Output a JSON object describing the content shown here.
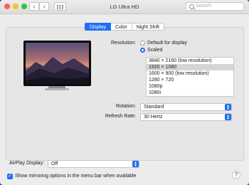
{
  "window": {
    "title": "LG Ultra HD"
  },
  "toolbar": {
    "back_glyph": "‹",
    "forward_glyph": "›",
    "search_placeholder": "Search"
  },
  "tabs": [
    {
      "label": "Display",
      "active": true
    },
    {
      "label": "Color",
      "active": false
    },
    {
      "label": "Night Shift",
      "active": false
    }
  ],
  "resolution": {
    "label": "Resolution:",
    "options": [
      {
        "label": "Default for display",
        "selected": false
      },
      {
        "label": "Scaled",
        "selected": true
      }
    ],
    "list": [
      "3840 × 2160 (low resolution)",
      "1920 × 1080",
      "1600 × 900 (low resolution)",
      "1280 × 720",
      "1080p",
      "1080i"
    ],
    "selected_index": 1
  },
  "rotation": {
    "label": "Rotation:",
    "value": "Standard"
  },
  "refresh": {
    "label": "Refresh Rate:",
    "value": "30 Hertz"
  },
  "airplay": {
    "label": "AirPlay Display:",
    "value": "Off"
  },
  "mirroring": {
    "label": "Show mirroring options in the menu bar when available",
    "checked": true
  },
  "help": {
    "glyph": "?"
  },
  "colors": {
    "accent": "#1f6ff0"
  }
}
